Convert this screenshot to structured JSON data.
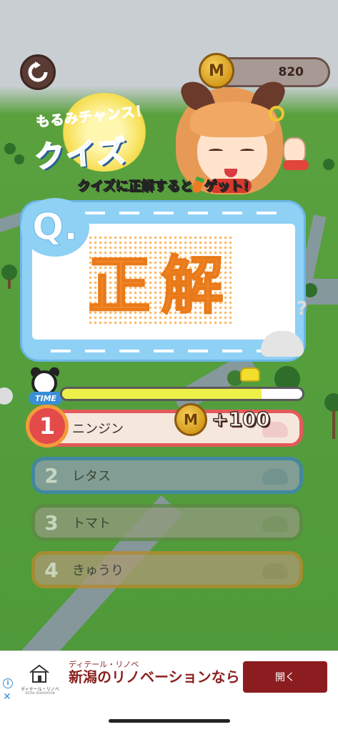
{
  "header": {
    "coins": "820",
    "coin_symbol": "M"
  },
  "logo": {
    "top_text": "もるみチャンス！",
    "main_text": "クイズ"
  },
  "banner": {
    "text_before": "クイズに正解すると",
    "text_after": "ゲット！",
    "reward_icon": "carrot-icon"
  },
  "quiz": {
    "badge": "Q.",
    "result": "正解",
    "timer": {
      "label": "TIME",
      "remaining": 0.83
    }
  },
  "options": [
    {
      "number": "1",
      "label": "ニンジン",
      "correct": true,
      "color": "#e35a5a"
    },
    {
      "number": "2",
      "label": "レタス",
      "correct": false,
      "color": "#3e84b9"
    },
    {
      "number": "3",
      "label": "トマト",
      "correct": false,
      "color": "#5d8a43"
    },
    {
      "number": "4",
      "label": "きゅうり",
      "correct": false,
      "color": "#b88a2e"
    }
  ],
  "reward": {
    "coin_symbol": "M",
    "amount": "+100"
  },
  "ad": {
    "brand": "ディテール・リノベ",
    "brand_sub": "DETAIL RENOVATION",
    "subtitle": "ディテール・リノベ",
    "title": "新潟のリノベーションなら",
    "cta": "開く",
    "info_icon": "i",
    "close_icon": "✕"
  },
  "colors": {
    "accent_orange": "#f28a2c",
    "card_blue": "#8fd0f5",
    "ad_red": "#8b1d20"
  }
}
